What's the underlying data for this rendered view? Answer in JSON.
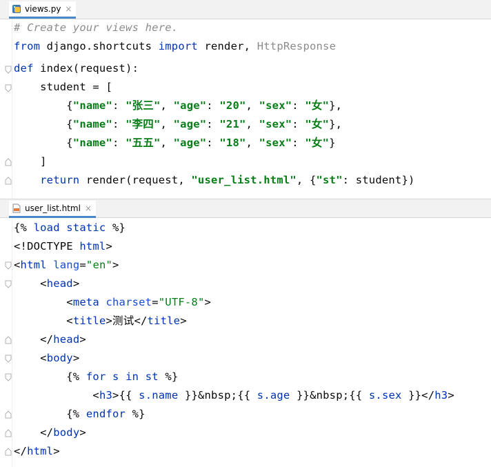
{
  "tabs": {
    "top": {
      "file": "views.py",
      "close": "×"
    },
    "bottom": {
      "file": "user_list.html",
      "close": "×"
    }
  },
  "python": {
    "l1": "# Create your views here.",
    "l2": {
      "kw_from": "from",
      "mod": " django.shortcuts ",
      "kw_import": "import",
      "names": " render, ",
      "unused": "HttpResponse"
    },
    "l3": {
      "kw": "def",
      "rest": " index(request):"
    },
    "l4": "    student = [",
    "rows": [
      {
        "indent": "        {",
        "k1": "\"name\"",
        "sep1": ": ",
        "v1": "\"张三\"",
        "c1": ", ",
        "k2": "\"age\"",
        "sep2": ": ",
        "v2": "\"20\"",
        "c2": ", ",
        "k3": "\"sex\"",
        "sep3": ": ",
        "v3": "\"女\"",
        "end": "},"
      },
      {
        "indent": "        {",
        "k1": "\"name\"",
        "sep1": ": ",
        "v1": "\"李四\"",
        "c1": ", ",
        "k2": "\"age\"",
        "sep2": ": ",
        "v2": "\"21\"",
        "c2": ", ",
        "k3": "\"sex\"",
        "sep3": ": ",
        "v3": "\"女\"",
        "end": "},"
      },
      {
        "indent": "        {",
        "k1": "\"name\"",
        "sep1": ": ",
        "v1": "\"五五\"",
        "c1": ", ",
        "k2": "\"age\"",
        "sep2": ": ",
        "v2": "\"18\"",
        "c2": ", ",
        "k3": "\"sex\"",
        "sep3": ": ",
        "v3": "\"女\"",
        "end": "}"
      }
    ],
    "l8": "    ]",
    "l9": {
      "indent": "    ",
      "kw": "return",
      "mid": " render(request, ",
      "s1": "\"user_list.html\"",
      "c": ", {",
      "s2": "\"st\"",
      "end": ": student})"
    }
  },
  "html": {
    "l1": {
      "open": "{%",
      "body": " load static ",
      "close": "%}"
    },
    "l2": {
      "a": "<!DOCTYPE ",
      "b": "html",
      "c": ">"
    },
    "l3": {
      "a": "<",
      "tag": "html",
      "attr": " lang",
      "eq": "=",
      "val": "\"en\"",
      "c": ">"
    },
    "l4": {
      "ind": "    ",
      "a": "<",
      "tag": "head",
      "c": ">"
    },
    "l5": {
      "ind": "        ",
      "a": "<",
      "tag": "meta",
      "attr": " charset",
      "eq": "=",
      "val": "\"UTF-8\"",
      "c": ">"
    },
    "l6": {
      "ind": "        ",
      "a": "<",
      "tag": "title",
      "c": ">",
      "text": "测试",
      "e1": "</",
      "etag": "title",
      "e2": ">"
    },
    "l7": {
      "ind": "    ",
      "a": "</",
      "tag": "head",
      "c": ">"
    },
    "l8": {
      "ind": "    ",
      "a": "<",
      "tag": "body",
      "c": ">"
    },
    "l9": {
      "ind": "        ",
      "open": "{% ",
      "kw1": "for",
      "s": " s ",
      "kw2": "in",
      "st": " st ",
      "close": "%}"
    },
    "l10": {
      "ind": "            ",
      "a": "<",
      "tag": "h3",
      "c": ">",
      "o1": "{{ ",
      "v1": "s.name",
      "x1": " }}",
      "n1": "&nbsp;",
      "o2": "{{ ",
      "v2": "s.age",
      "x2": " }}",
      "n2": "&nbsp;",
      "o3": "{{ ",
      "v3": "s.sex",
      "x3": " }}",
      "e1": "</",
      "etag": "h3",
      "e2": ">"
    },
    "l11": {
      "ind": "        ",
      "open": "{% ",
      "kw": "endfor",
      "close": " %}"
    },
    "l12": {
      "ind": "    ",
      "a": "</",
      "tag": "body",
      "c": ">"
    },
    "l13": {
      "a": "</",
      "tag": "html",
      "c": ">"
    }
  },
  "colors": {
    "keyword": "#0033b3",
    "string": "#067d17",
    "comment": "#8c8c8c",
    "tab_underline": "#4a88c7"
  }
}
